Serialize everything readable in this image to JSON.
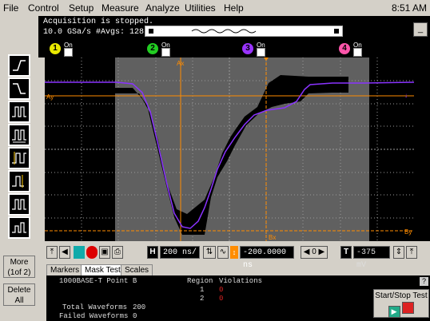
{
  "menubar": {
    "items": [
      "File",
      "Control",
      "Setup",
      "Measure",
      "Analyze",
      "Utilities",
      "Help"
    ],
    "clock": "8:51 AM"
  },
  "status": {
    "line1": "Acquisition is stopped.",
    "line2": "10.0 GSa/s  #Avgs: 128",
    "minimize": "_"
  },
  "channels": [
    {
      "num": "1",
      "label": "On",
      "color": "#e8e800"
    },
    {
      "num": "2",
      "label": "On",
      "color": "#22cc22"
    },
    {
      "num": "3",
      "label": "On",
      "color": "#9933ff"
    },
    {
      "num": "4",
      "label": "On",
      "color": "#ff55aa"
    }
  ],
  "toolbar": {
    "more_line1": "More",
    "more_line2": "(1of 2)",
    "delete_line1": "Delete",
    "delete_line2": "All"
  },
  "scope": {
    "marker_ax": "Ax",
    "marker_bx": "Bx",
    "marker_ay": "Ay",
    "marker_by": "By"
  },
  "controls": {
    "h_label": "H",
    "timebase": "200 ns/",
    "delay": "-200.0000 ns",
    "t_label": "T",
    "trigger_level": "-375 mV"
  },
  "tabs": [
    "Markers",
    "Mask Test",
    "Scales"
  ],
  "mask_test": {
    "mask_name": "1000BASE-T Point B",
    "region_header": "Region",
    "violations_header": "Violations",
    "regions": [
      {
        "region": "1",
        "violations": "0"
      },
      {
        "region": "2",
        "violations": "0"
      }
    ],
    "total_label": "Total Waveforms",
    "total_value": "200",
    "failed_label": "Failed Waveforms",
    "failed_value": "0",
    "help": "?"
  },
  "start_stop": {
    "label": "Start/Stop Test"
  },
  "colors": {
    "trace": "#8a33ff",
    "marker": "#ff8c00",
    "mask_band": "#000000",
    "scope_bg": "#606060"
  }
}
